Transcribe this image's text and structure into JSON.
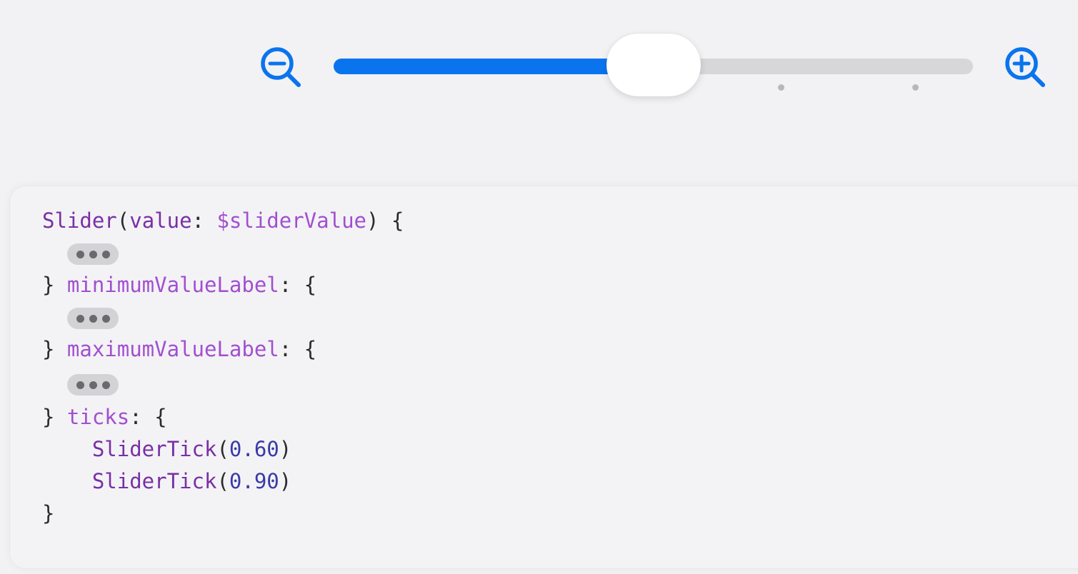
{
  "slider": {
    "value": 0.5,
    "min": 0.0,
    "max": 1.0,
    "ticks": [
      0.7,
      0.91
    ],
    "accent_color": "#0a74ef",
    "min_icon": "zoom-out-icon",
    "max_icon": "zoom-in-icon"
  },
  "code": {
    "line1": {
      "type": "Slider",
      "open_paren": "(",
      "param": "value",
      "colon": ": ",
      "binding": "$sliderValue",
      "close": ") {"
    },
    "line3": {
      "brace": "} ",
      "label": "minimumValueLabel",
      "rest": ": {"
    },
    "line5": {
      "brace": "} ",
      "label": "maximumValueLabel",
      "rest": ": {"
    },
    "line7": {
      "brace": "} ",
      "label": "ticks",
      "rest": ": {"
    },
    "tick1": {
      "type": "SliderTick",
      "open": "(",
      "value": "0.60",
      "close": ")"
    },
    "tick2": {
      "type": "SliderTick",
      "open": "(",
      "value": "0.90",
      "close": ")"
    },
    "closing": "}"
  }
}
